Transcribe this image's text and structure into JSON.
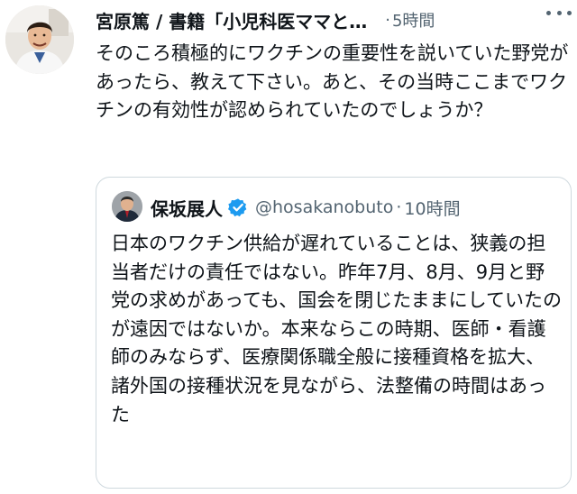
{
  "tweet": {
    "author_name": "宮原篤 / 書籍「小児科医ママと…",
    "dot": "·",
    "time": "5時間",
    "text": "そのころ積極的にワクチンの重要性を説いていた野党があったら、教えて下さい。あと、その当時ここまでワクチンの有効性が認められていたのでしょうか？",
    "more_icon": "more-horizontal-icon"
  },
  "quote": {
    "author_name": "保坂展人",
    "verified_icon": "verified-badge-icon",
    "handle": "@hosakanobuto",
    "dot": "·",
    "time": "10時間",
    "text": "日本のワクチン供給が遅れていることは、狭義の担当者だけの責任ではない。昨年7月、8月、9月と野党の求めがあっても、国会を閉じたままにしていたのが遠因ではないか。本来ならこの時期、医師・看護師のみならず、医療関係職全般に接種資格を拡大、諸外国の接種状況を見ながら、法整備の時間はあった"
  },
  "colors": {
    "text": "#0f1419",
    "secondary": "#536471",
    "border": "#cfd9de",
    "verified": "#1d9bf0"
  }
}
